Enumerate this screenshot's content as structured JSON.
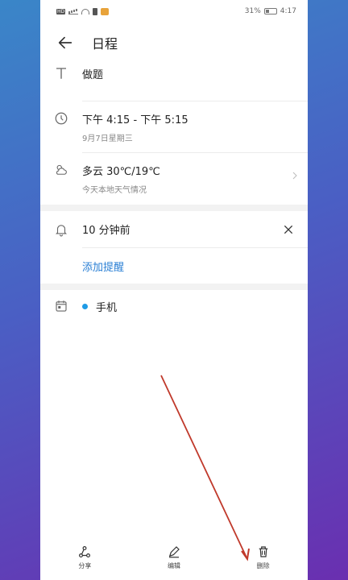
{
  "status_bar": {
    "network": "HD",
    "battery_percent": "31%",
    "time": "4:17"
  },
  "header": {
    "title": "日程"
  },
  "event": {
    "title": "做题",
    "time_range": "下午 4:15 - 下午 5:15",
    "date": "9月7日星期三"
  },
  "weather": {
    "summary": "多云 30℃/19℃",
    "note": "今天本地天气情况"
  },
  "reminder": {
    "label": "10 分钟前",
    "add_label": "添加提醒"
  },
  "calendar": {
    "name": "手机",
    "dot_color": "#1e9be6"
  },
  "bottom_nav": {
    "share_label": "分享",
    "edit_label": "编辑",
    "delete_label": "删除"
  },
  "colors": {
    "accent": "#2a7fd4",
    "annotation_arrow": "#c0392b"
  }
}
